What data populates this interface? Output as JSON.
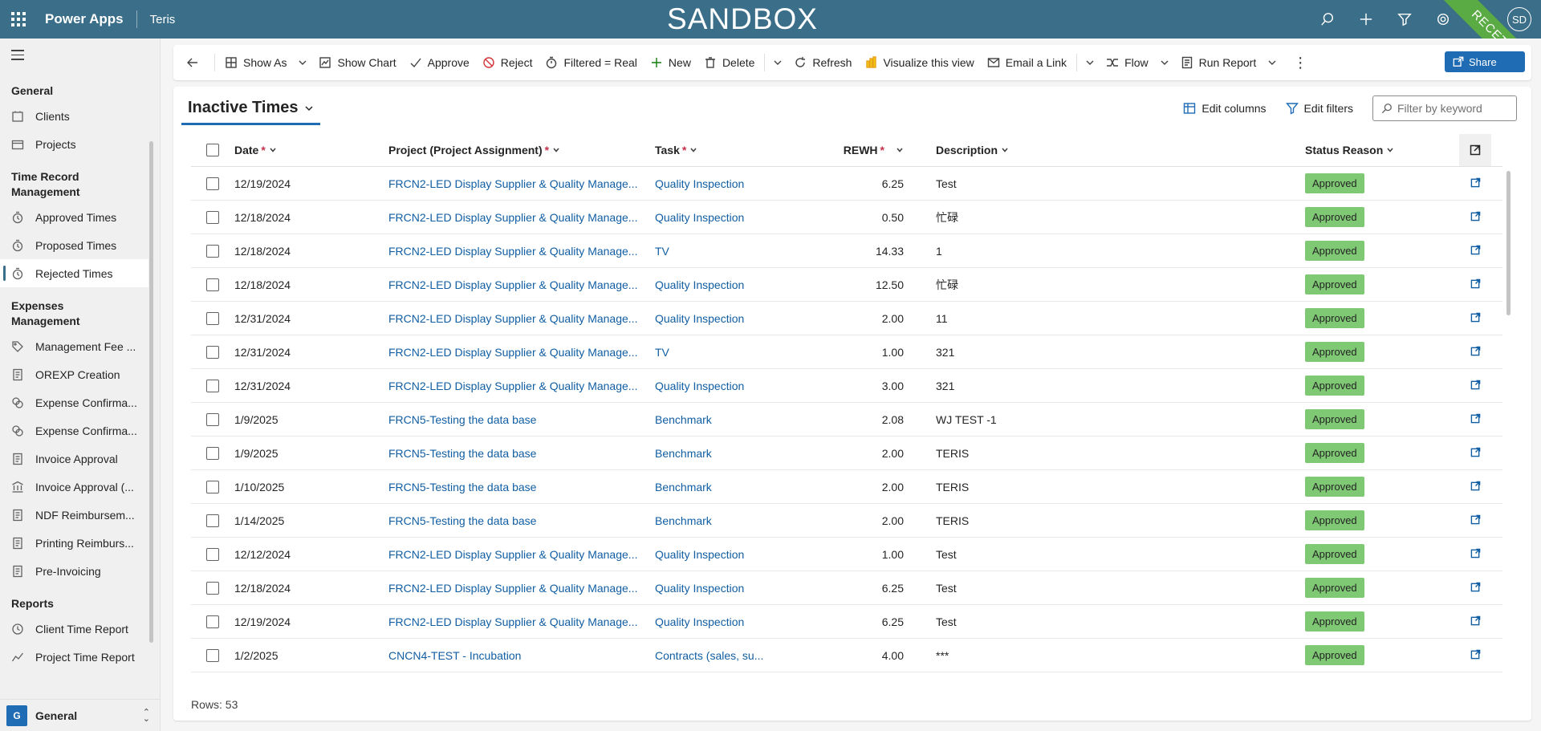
{
  "topbar": {
    "app_name": "Power Apps",
    "environment": "Teris",
    "banner": "SANDBOX",
    "ribbon": "RECETTE",
    "avatar_initials": "SD",
    "icons": [
      "search-icon",
      "plus-icon",
      "filter-icon",
      "gear-icon",
      "help-icon"
    ]
  },
  "sidebar": {
    "groups": [
      {
        "label": "General",
        "items": [
          {
            "label": "Clients",
            "icon": "clients-icon"
          },
          {
            "label": "Projects",
            "icon": "projects-icon"
          }
        ]
      },
      {
        "label": "Time Record Management",
        "items": [
          {
            "label": "Approved Times",
            "icon": "time-icon"
          },
          {
            "label": "Proposed Times",
            "icon": "time-icon"
          },
          {
            "label": "Rejected Times",
            "icon": "time-icon",
            "active": true
          }
        ]
      },
      {
        "label": "Expenses Management",
        "items": [
          {
            "label": "Management Fee ...",
            "icon": "tag-icon"
          },
          {
            "label": "OREXP Creation",
            "icon": "document-icon"
          },
          {
            "label": "Expense Confirma...",
            "icon": "coins-icon"
          },
          {
            "label": "Expense Confirma...",
            "icon": "coins-icon"
          },
          {
            "label": "Invoice Approval",
            "icon": "document-icon"
          },
          {
            "label": "Invoice Approval (...",
            "icon": "bank-icon"
          },
          {
            "label": "NDF Reimbursem...",
            "icon": "document-icon"
          },
          {
            "label": "Printing Reimburs...",
            "icon": "document-icon"
          },
          {
            "label": "Pre-Invoicing",
            "icon": "document-icon"
          }
        ]
      },
      {
        "label": "Reports",
        "items": [
          {
            "label": "Client Time Report",
            "icon": "clock-icon"
          },
          {
            "label": "Project Time Report",
            "icon": "chart-line-icon"
          }
        ]
      }
    ],
    "area": {
      "badge": "G",
      "label": "General"
    }
  },
  "commandbar": {
    "show_as": "Show As",
    "show_chart": "Show Chart",
    "approve": "Approve",
    "reject": "Reject",
    "filtered": "Filtered = Real",
    "new": "New",
    "delete": "Delete",
    "refresh": "Refresh",
    "visualize": "Visualize this view",
    "email_link": "Email a Link",
    "flow": "Flow",
    "run_report": "Run Report",
    "share": "Share"
  },
  "view": {
    "title": "Inactive Times",
    "edit_columns": "Edit columns",
    "edit_filters": "Edit filters",
    "search_placeholder": "Filter by keyword",
    "rows_label": "Rows: 53"
  },
  "grid": {
    "columns": {
      "date": "Date",
      "project": "Project (Project Assignment)",
      "task": "Task",
      "rewh": "REWH",
      "description": "Description",
      "status": "Status Reason",
      "required_mark": "*"
    },
    "rows": [
      {
        "date": "12/19/2024",
        "project": "FRCN2-LED Display Supplier & Quality Manage...",
        "task": "Quality Inspection",
        "rewh": "6.25",
        "description": "Test",
        "status": "Approved"
      },
      {
        "date": "12/18/2024",
        "project": "FRCN2-LED Display Supplier & Quality Manage...",
        "task": "Quality Inspection",
        "rewh": "0.50",
        "description": "忙碌",
        "status": "Approved"
      },
      {
        "date": "12/18/2024",
        "project": "FRCN2-LED Display Supplier & Quality Manage...",
        "task": "TV",
        "rewh": "14.33",
        "description": "1",
        "status": "Approved"
      },
      {
        "date": "12/18/2024",
        "project": "FRCN2-LED Display Supplier & Quality Manage...",
        "task": "Quality Inspection",
        "rewh": "12.50",
        "description": "忙碌",
        "status": "Approved"
      },
      {
        "date": "12/31/2024",
        "project": "FRCN2-LED Display Supplier & Quality Manage...",
        "task": "Quality Inspection",
        "rewh": "2.00",
        "description": "11",
        "status": "Approved"
      },
      {
        "date": "12/31/2024",
        "project": "FRCN2-LED Display Supplier & Quality Manage...",
        "task": "TV",
        "rewh": "1.00",
        "description": "321",
        "status": "Approved"
      },
      {
        "date": "12/31/2024",
        "project": "FRCN2-LED Display Supplier & Quality Manage...",
        "task": "Quality Inspection",
        "rewh": "3.00",
        "description": "321",
        "status": "Approved"
      },
      {
        "date": "1/9/2025",
        "project": "FRCN5-Testing the data base",
        "task": "Benchmark",
        "rewh": "2.08",
        "description": "WJ TEST -1",
        "status": "Approved"
      },
      {
        "date": "1/9/2025",
        "project": "FRCN5-Testing the data base",
        "task": "Benchmark",
        "rewh": "2.00",
        "description": "TERIS",
        "status": "Approved"
      },
      {
        "date": "1/10/2025",
        "project": "FRCN5-Testing the data base",
        "task": "Benchmark",
        "rewh": "2.00",
        "description": "TERIS",
        "status": "Approved"
      },
      {
        "date": "1/14/2025",
        "project": "FRCN5-Testing the data base",
        "task": "Benchmark",
        "rewh": "2.00",
        "description": "TERIS",
        "status": "Approved"
      },
      {
        "date": "12/12/2024",
        "project": "FRCN2-LED Display Supplier & Quality Manage...",
        "task": "Quality Inspection",
        "rewh": "1.00",
        "description": "Test",
        "status": "Approved"
      },
      {
        "date": "12/18/2024",
        "project": "FRCN2-LED Display Supplier & Quality Manage...",
        "task": "Quality Inspection",
        "rewh": "6.25",
        "description": "Test",
        "status": "Approved"
      },
      {
        "date": "12/19/2024",
        "project": "FRCN2-LED Display Supplier & Quality Manage...",
        "task": "Quality Inspection",
        "rewh": "6.25",
        "description": "Test",
        "status": "Approved"
      },
      {
        "date": "1/2/2025",
        "project": "CNCN4-TEST - Incubation",
        "task": "Contracts (sales, su...",
        "rewh": "4.00",
        "description": "***",
        "status": "Approved"
      }
    ]
  },
  "colors": {
    "topbar": "#3b6e89",
    "accent": "#1f6cb4",
    "link": "#115ea3",
    "approved_badge": "#7fc874",
    "ribbon": "#5bab45"
  }
}
